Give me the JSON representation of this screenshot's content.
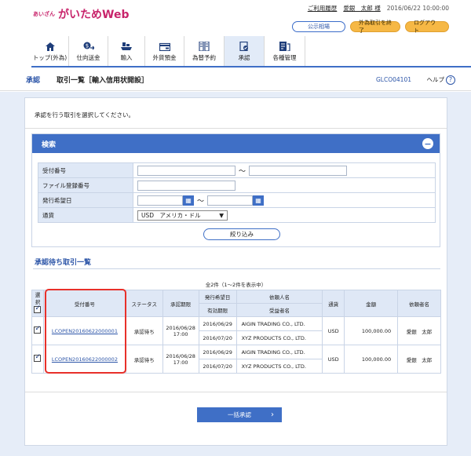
{
  "header": {
    "logo_small": "あいざん",
    "logo_main": "がいためWeb",
    "history_link": "ご利用履歴",
    "user": "愛銀　太郎 様",
    "datetime": "2016/06/22 10:00:00",
    "rates_button": "公示相場",
    "end_fx_button": "外為取引を終了",
    "logout_button": "ログアウト"
  },
  "nav": {
    "items": [
      {
        "label": "トップ(外為)",
        "icon": "home-icon"
      },
      {
        "label": "仕向送金",
        "icon": "remittance-icon"
      },
      {
        "label": "輸入",
        "icon": "import-icon"
      },
      {
        "label": "外貨預金",
        "icon": "deposit-icon"
      },
      {
        "label": "為替予約",
        "icon": "fx-contract-icon"
      },
      {
        "label": "承認",
        "icon": "approval-icon"
      },
      {
        "label": "各種管理",
        "icon": "management-icon"
      }
    ]
  },
  "subheader": {
    "section": "承認",
    "title": "取引一覧［輸入信用状開設］",
    "code": "GLCO04101",
    "help": "ヘルプ"
  },
  "instruction": "承認を行う取引を選択してください。",
  "search": {
    "title": "検索",
    "labels": {
      "receipt_no": "受付番号",
      "file_no": "ファイル登録番号",
      "issue_date": "発行希望日",
      "currency": "通貨"
    },
    "tilde": "～",
    "currency_value": "USD　アメリカ・ドル",
    "refine_button": "絞り込み"
  },
  "list": {
    "title": "承認待ち取引一覧",
    "count": "全2件（1～2件を表示中）",
    "headers": {
      "select": "選択",
      "receipt_no": "受付番号",
      "status": "ステータス",
      "deadline": "承認期限",
      "issue_date": "発行希望日",
      "expiry": "有効期限",
      "applicant": "依頼人名",
      "beneficiary": "受益者名",
      "currency": "通貨",
      "amount": "金額",
      "requester": "依頼者名"
    },
    "rows": [
      {
        "receipt_no": "LCOPEN20160622000001",
        "status": "承認待ち",
        "deadline": "2016/06/28",
        "deadline_time": "17:00",
        "issue_date": "2016/06/29",
        "expiry": "2016/07/20",
        "applicant": "AIGIN TRADING CO., LTD.",
        "beneficiary": "XYZ PRODUCTS CO., LTD.",
        "currency": "USD",
        "amount": "100,000.00",
        "requester": "愛銀　太郎"
      },
      {
        "receipt_no": "LCOPEN20160622000002",
        "status": "承認待ち",
        "deadline": "2016/06/28",
        "deadline_time": "17:00",
        "issue_date": "2016/06/29",
        "expiry": "2016/07/20",
        "applicant": "AIGIN TRADING CO., LTD.",
        "beneficiary": "XYZ PRODUCTS CO., LTD.",
        "currency": "USD",
        "amount": "100,000.00",
        "requester": "愛銀　太郎"
      }
    ]
  },
  "bulk_approve_button": "一括承認",
  "colors": {
    "brand": "#c8246b",
    "primary": "#3f6fc6",
    "accent_orange": "#f6b845",
    "highlight_red": "#e8302a"
  }
}
